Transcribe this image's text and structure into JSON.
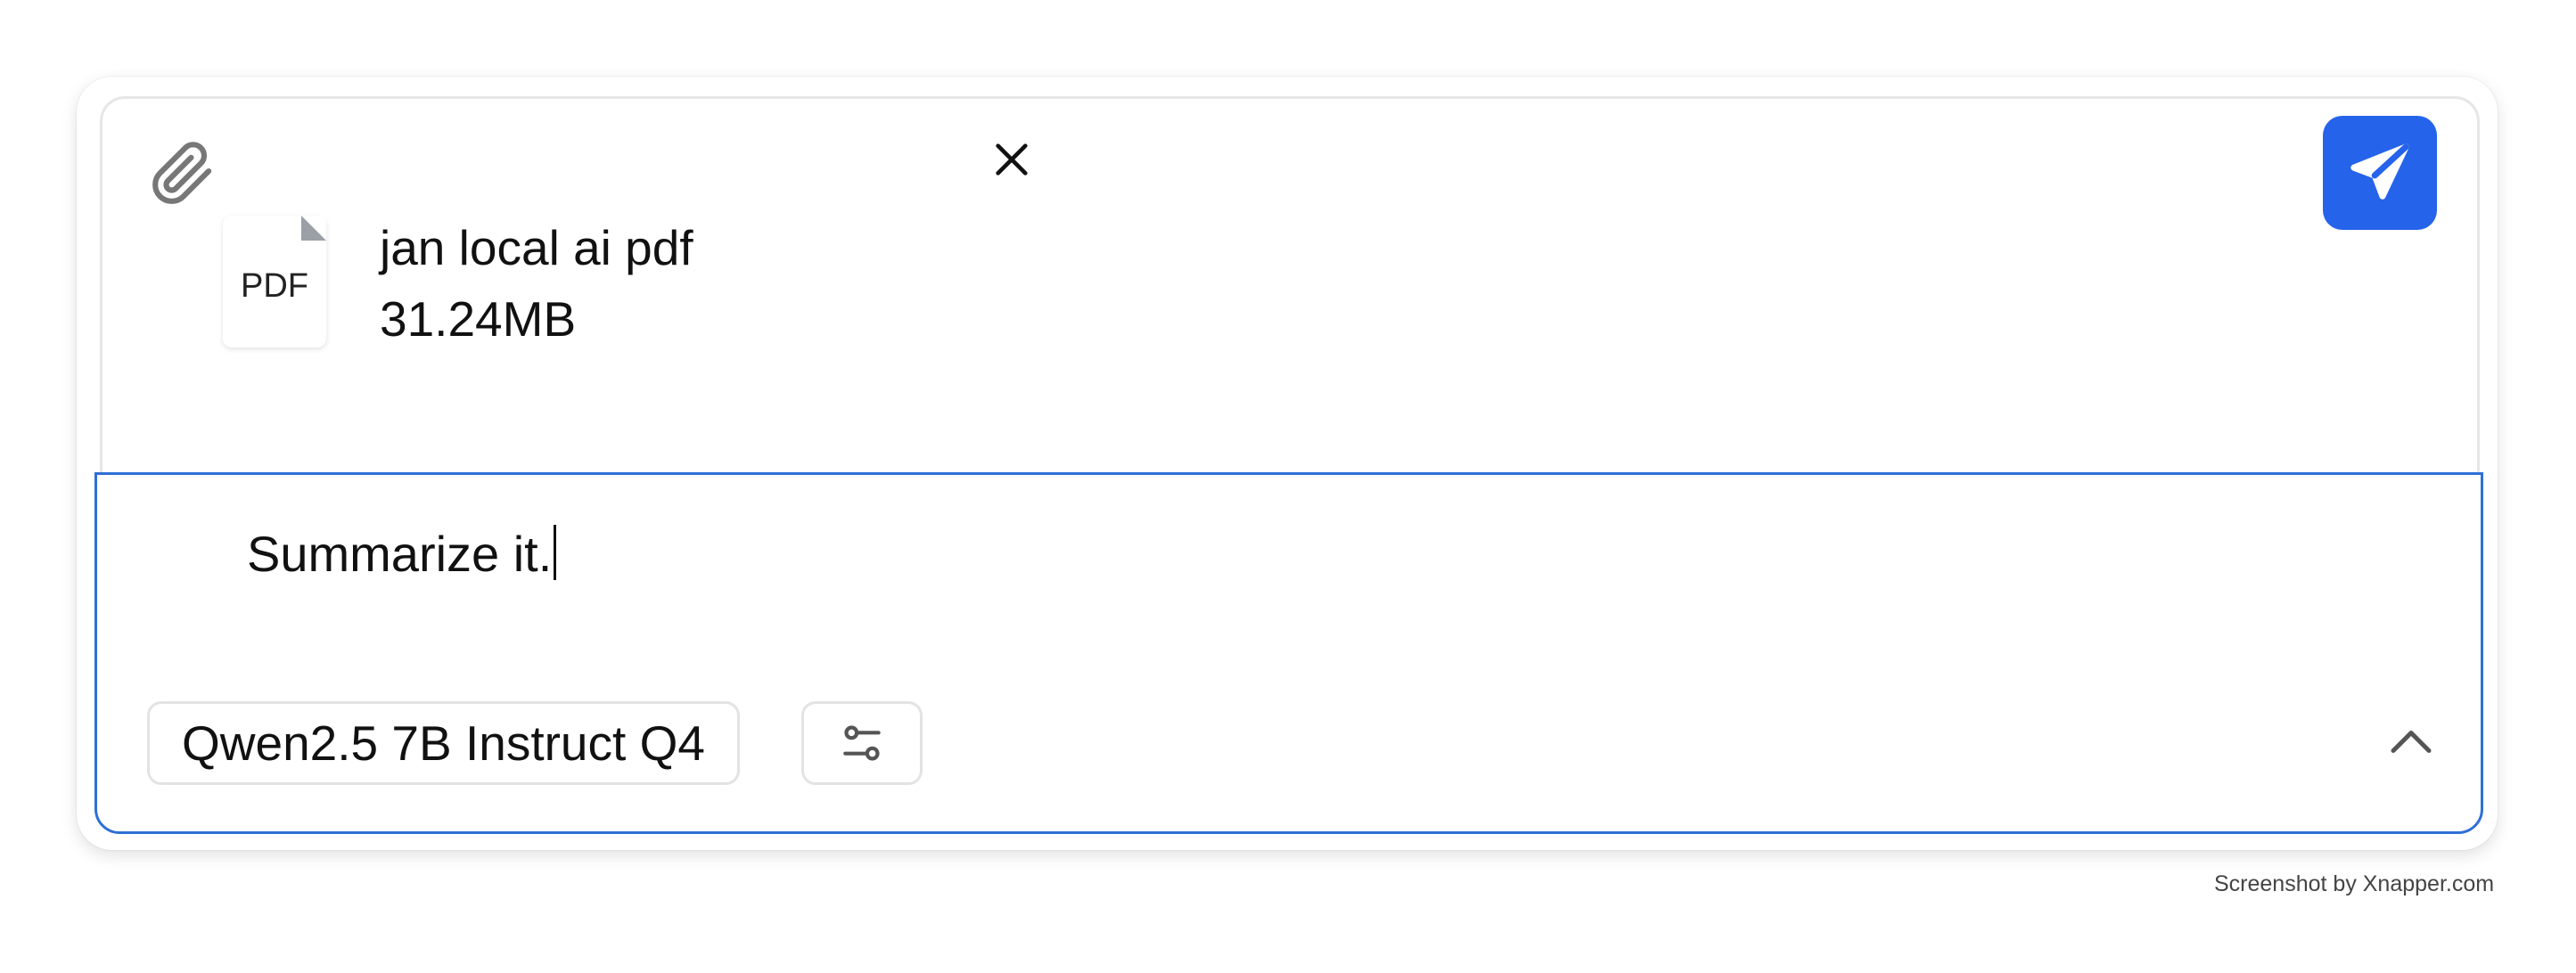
{
  "attachment": {
    "thumb_label": "PDF",
    "name": "jan local ai pdf",
    "size": "31.24MB"
  },
  "icons": {
    "attach": "paperclip-icon",
    "remove_attachment": "close-icon",
    "send": "paper-plane-icon",
    "settings": "sliders-icon",
    "expand": "chevron-up-icon"
  },
  "input": {
    "value": "Summarize it."
  },
  "model_selector": {
    "label": "Qwen2.5 7B Instruct Q4"
  },
  "watermark": "Screenshot by Xnapper.com",
  "colors": {
    "accent": "#2563eb",
    "focus_border": "#2f6fd6"
  }
}
